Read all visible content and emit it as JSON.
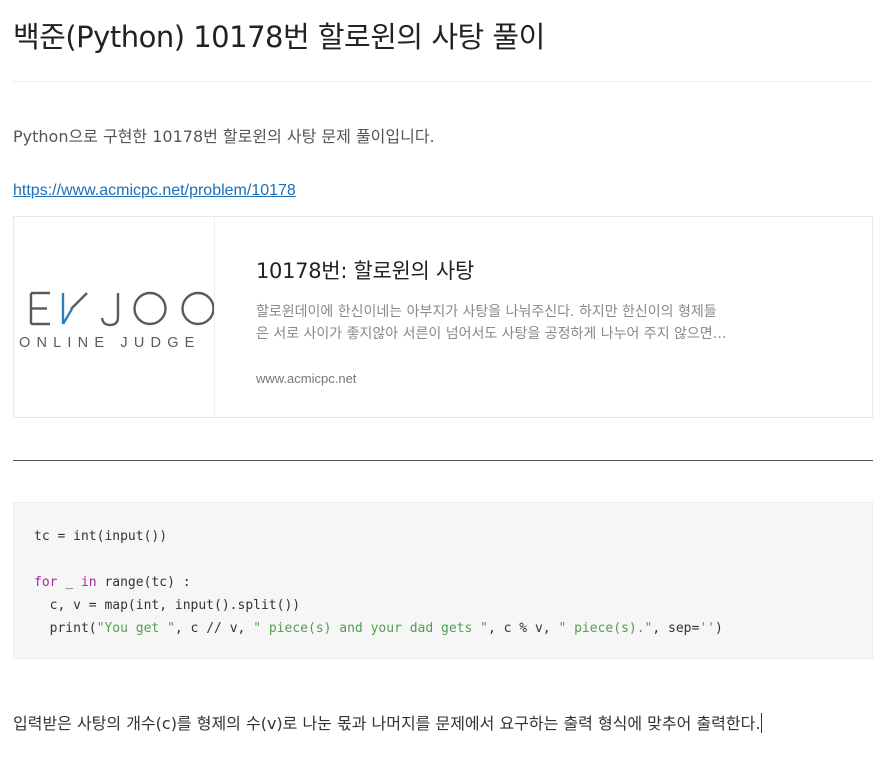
{
  "post": {
    "title": "백준(Python) 10178번 할로윈의 사탕 풀이",
    "intro": "Python으로 구현한 10178번 할로윈의 사탕 문제 풀이입니다.",
    "link_text": "https://www.acmicpc.net/problem/10178"
  },
  "link_card": {
    "logo_text": "BAEKJOON",
    "logo_sub": "ONLINE JUDGE",
    "title": "10178번: 할로윈의 사탕",
    "desc_line1": "할로윈데이에 한신이네는 아부지가 사탕을 나눠주신다. 하지만 한신이의 형제들",
    "desc_line2": "은 서로 사이가 좋지않아 서른이 넘어서도 사탕을 공정하게 나누어 주지 않으면…",
    "domain": "www.acmicpc.net"
  },
  "code": {
    "line1": "tc = int(input())",
    "line3_kw1": "for",
    "line3_mid": " _ ",
    "line3_kw2": "in",
    "line3_rest": " range(tc) :",
    "line4": "  c, v = map(int, input().split())",
    "line5_a": "  print(",
    "line5_s1": "\"You get \"",
    "line5_b": ", c // v, ",
    "line5_s2": "\" piece(s) and your dad gets \"",
    "line5_c": ", c % v, ",
    "line5_s3": "\" piece(s).\"",
    "line5_d": ", sep=",
    "line5_s4": "''",
    "line5_e": ")"
  },
  "closing": "입력받은 사탕의 개수(c)를 형제의 수(v)로 나눈 몫과 나머지를 문제에서 요구하는 출력 형식에 맞추어 출력한다.",
  "colors": {
    "link": "#1a6fb8",
    "keyword": "#a626a4",
    "string": "#50a14f",
    "logo": "#5a5a5a",
    "logo_accent": "#2a7fc1"
  }
}
